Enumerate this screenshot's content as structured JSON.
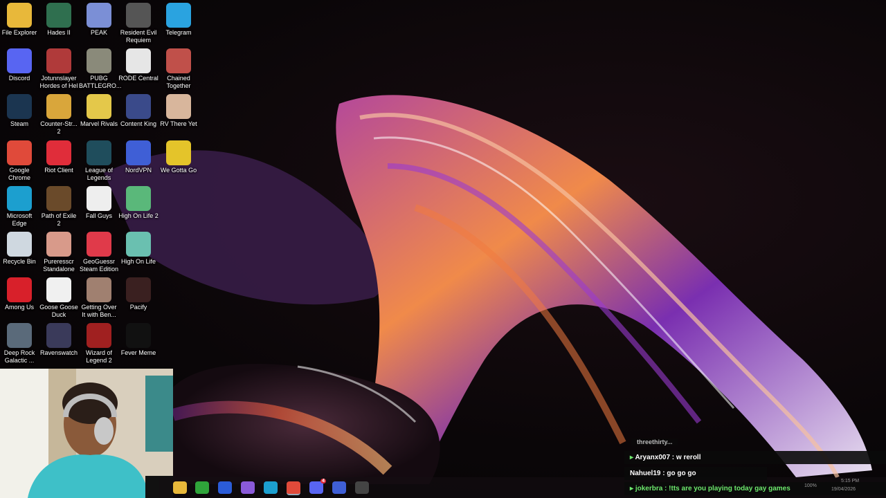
{
  "desktop_icons": [
    {
      "label": "File Explorer",
      "icon": "folder-icon",
      "color": "#e8b83a"
    },
    {
      "label": "Hades II",
      "icon": "hades-icon",
      "color": "#2f6f4f"
    },
    {
      "label": "PEAK",
      "icon": "mountain-icon",
      "color": "#7b8fd6"
    },
    {
      "label": "Resident Evil Requiem",
      "icon": "resident-evil-icon",
      "color": "#555"
    },
    {
      "label": "Telegram",
      "icon": "paper-plane-icon",
      "color": "#2aa3e0"
    },
    {
      "label": "Discord",
      "icon": "discord-icon",
      "color": "#5865f2"
    },
    {
      "label": "Jotunnslayer Hordes of Hel",
      "icon": "jotunnslayer-icon",
      "color": "#b03a3a"
    },
    {
      "label": "PUBG BATTLEGRO...",
      "icon": "helmet-icon",
      "color": "#8a8a7a"
    },
    {
      "label": "RODE Central",
      "icon": "rode-icon",
      "color": "#e6e6e6"
    },
    {
      "label": "Chained Together",
      "icon": "chain-icon",
      "color": "#c0504a"
    },
    {
      "label": "Steam",
      "icon": "steam-icon",
      "color": "#1b3550"
    },
    {
      "label": "Counter-Str... 2",
      "icon": "counter-strike-icon",
      "color": "#d9a63b"
    },
    {
      "label": "Marvel Rivals",
      "icon": "marvel-rivals-icon",
      "color": "#e4c84a"
    },
    {
      "label": "Content King",
      "icon": "content-king-icon",
      "color": "#3a4a8a"
    },
    {
      "label": "RV There Yet",
      "icon": "rv-icon",
      "color": "#d8b69c"
    },
    {
      "label": "Google Chrome",
      "icon": "chrome-icon",
      "color": "#e04a3a"
    },
    {
      "label": "Riot Client",
      "icon": "riot-fist-icon",
      "color": "#e02d3a"
    },
    {
      "label": "League of Legends",
      "icon": "league-icon",
      "color": "#1f4d5c"
    },
    {
      "label": "NordVPN",
      "icon": "nordvpn-icon",
      "color": "#3f5fd6"
    },
    {
      "label": "We Gotta Go",
      "icon": "we-gotta-go-icon",
      "color": "#e4c42a"
    },
    {
      "label": "Microsoft Edge",
      "icon": "edge-icon",
      "color": "#1c9fcf"
    },
    {
      "label": "Path of Exile 2",
      "icon": "path-of-exile-icon",
      "color": "#6a4a2a"
    },
    {
      "label": "Fall Guys",
      "icon": "file-icon",
      "color": "#eeeeee"
    },
    {
      "label": "High On Life 2",
      "icon": "alien-gun-icon",
      "color": "#5ab87a"
    },
    {
      "label": "",
      "icon": "",
      "color": ""
    },
    {
      "label": "Recycle Bin",
      "icon": "recycle-bin-icon",
      "color": "#cfd8e0"
    },
    {
      "label": "Pureresscr Standalone",
      "icon": "face-icon",
      "color": "#d89a8a"
    },
    {
      "label": "GeoGuessr Steam Edition",
      "icon": "map-pin-icon",
      "color": "#e03a4a"
    },
    {
      "label": "High On Life",
      "icon": "alien-gun-icon",
      "color": "#6ac0b0"
    },
    {
      "label": "",
      "icon": "",
      "color": ""
    },
    {
      "label": "Among Us",
      "icon": "among-us-icon",
      "color": "#d8202a"
    },
    {
      "label": "Goose Goose Duck",
      "icon": "goose-icon",
      "color": "#f0f0f0"
    },
    {
      "label": "Getting Over It with Ben...",
      "icon": "hammer-icon",
      "color": "#a08070"
    },
    {
      "label": "Pacify",
      "icon": "pacify-icon",
      "color": "#3a2020"
    },
    {
      "label": "",
      "icon": "",
      "color": ""
    },
    {
      "label": "Deep Rock Galactic ...",
      "icon": "deep-rock-icon",
      "color": "#5a6a7a"
    },
    {
      "label": "Ravenswatch",
      "icon": "raven-icon",
      "color": "#3a3a5a"
    },
    {
      "label": "Wizard of Legend 2",
      "icon": "wizard-icon",
      "color": "#a02020"
    },
    {
      "label": "Fever Meme",
      "icon": "fever-meme-icon",
      "color": "#111111"
    },
    {
      "label": "",
      "icon": "",
      "color": ""
    }
  ],
  "chat": {
    "partial": "threethirty...",
    "messages": [
      {
        "user": "Aryanx007",
        "text": "w reroll",
        "color": "#ffffff"
      },
      {
        "user": "Nahuel19",
        "text": "go go go",
        "color": "#ffffff"
      },
      {
        "user": "jokerbra",
        "text": "!tts are you playing today gay games",
        "color": "#6de86d"
      }
    ]
  },
  "tray": {
    "battery": "100%",
    "time": "5:15 PM",
    "date": "19/04/2026"
  },
  "taskbar_apps": [
    "file-explorer-icon",
    "xbox-icon",
    "tasks-icon",
    "copilot-icon",
    "edge-icon",
    "chrome-icon",
    "discord-icon",
    "nordvpn-icon",
    "steam-icon"
  ],
  "notification_badge": "4"
}
